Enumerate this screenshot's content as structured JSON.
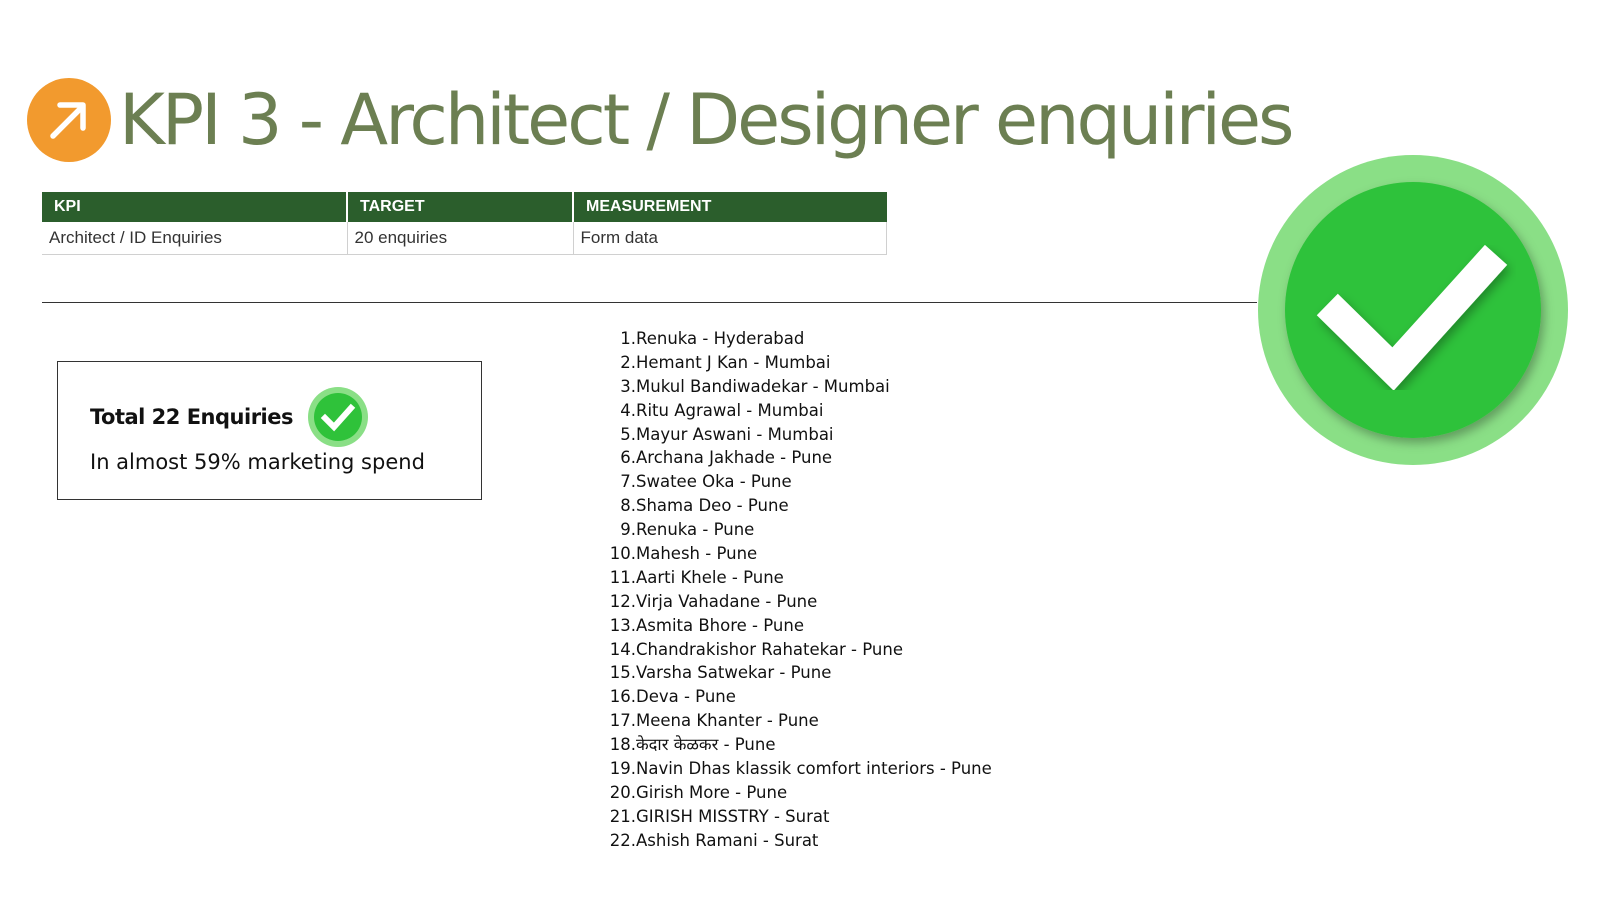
{
  "title": "KPI 3 - Architect / Designer enquiries",
  "accent_colors": {
    "title": "#6c7f52",
    "arrow_badge": "#f29a2e",
    "table_header": "#2b5e2c",
    "check_green": "#2fc23a",
    "check_ring": "#8adf86"
  },
  "icons": {
    "title_badge": "arrow-up-right-icon",
    "summary_check": "check-circle-icon",
    "big_check": "check-circle-icon"
  },
  "kpi_table": {
    "headers": [
      "KPI",
      "TARGET",
      "MEASUREMENT"
    ],
    "row": [
      "Architect / ID Enquiries",
      "20 enquiries",
      "Form data"
    ]
  },
  "summary": {
    "title": "Total 22 Enquiries",
    "subtitle": "In almost 59% marketing spend"
  },
  "enquiries": [
    {
      "num": "1.",
      "text": "Renuka - Hyderabad"
    },
    {
      "num": "2.",
      "text": "Hemant J Kan - Mumbai"
    },
    {
      "num": "3.",
      "text": "Mukul Bandiwadekar - Mumbai"
    },
    {
      "num": "4.",
      "text": "Ritu Agrawal - Mumbai"
    },
    {
      "num": "5.",
      "text": "Mayur Aswani - Mumbai"
    },
    {
      "num": "6.",
      "text": "Archana Jakhade - Pune"
    },
    {
      "num": "7.",
      "text": "Swatee Oka - Pune"
    },
    {
      "num": "8.",
      "text": "Shama Deo - Pune"
    },
    {
      "num": "9.",
      "text": "Renuka - Pune"
    },
    {
      "num": "10.",
      "text": "Mahesh - Pune"
    },
    {
      "num": "11.",
      "text": "Aarti Khele - Pune"
    },
    {
      "num": "12.",
      "text": "Virja Vahadane - Pune"
    },
    {
      "num": "13.",
      "text": "Asmita Bhore - Pune"
    },
    {
      "num": "14.",
      "text": "Chandrakishor Rahatekar - Pune"
    },
    {
      "num": "15.",
      "text": "Varsha Satwekar - Pune"
    },
    {
      "num": "16.",
      "text": "Deva - Pune"
    },
    {
      "num": "17.",
      "text": "Meena Khanter - Pune"
    },
    {
      "num": "18.",
      "text": "केदार केळकर - Pune"
    },
    {
      "num": "19.",
      "text": "Navin Dhas klassik comfort interiors - Pune"
    },
    {
      "num": "20.",
      "text": "Girish More - Pune"
    },
    {
      "num": "21.",
      "text": "GIRISH MISSTRY - Surat"
    },
    {
      "num": "22.",
      "text": "Ashish Ramani - Surat"
    }
  ]
}
